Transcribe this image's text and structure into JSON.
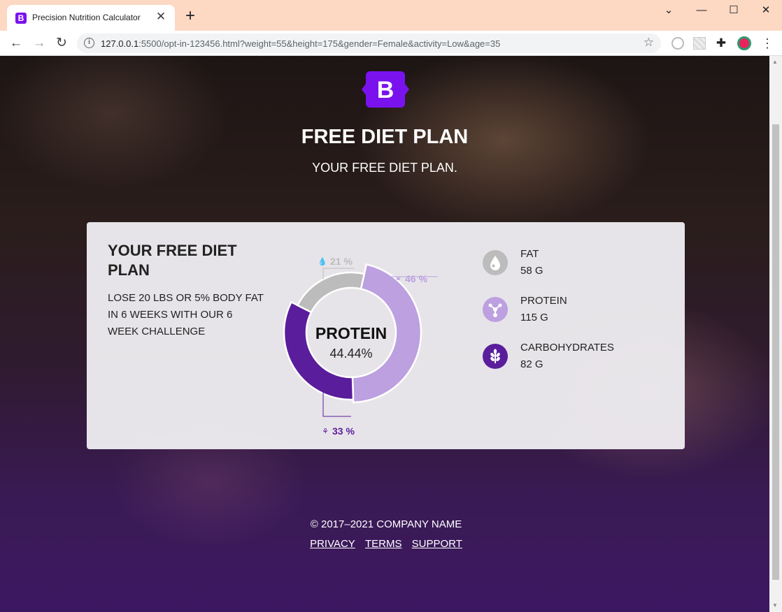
{
  "browser": {
    "tab_title": "Precision Nutrition Calculator",
    "favicon_letter": "B",
    "url_host": "127.0.0.1",
    "url_rest": ":5500/opt-in-123456.html?weight=55&height=175&gender=Female&activity=Low&age=35"
  },
  "hero": {
    "title": "FREE DIET PLAN",
    "subtitle": "YOUR FREE DIET PLAN."
  },
  "card": {
    "title": "YOUR FREE DIET PLAN",
    "description": "LOSE 20 LBS OR 5% BODY FAT IN 6 WEEKS WITH OUR 6 WEEK CHALLENGE",
    "donut": {
      "center_label": "PROTEIN",
      "center_value": "44.44%"
    },
    "macros": [
      {
        "name": "FAT",
        "value": "58 G",
        "color": "#bcbcbc",
        "icon": "drop-icon"
      },
      {
        "name": "PROTEIN",
        "value": "115 G",
        "color": "#bca0e0",
        "icon": "molecule-icon"
      },
      {
        "name": "CARBOHYDRATES",
        "value": "82 G",
        "color": "#5a1d9c",
        "icon": "wheat-icon"
      }
    ]
  },
  "chart_data": {
    "type": "pie",
    "categories": [
      "Protein",
      "Carbohydrates",
      "Fat"
    ],
    "values": [
      46,
      33,
      21
    ],
    "labels": [
      "46 %",
      "33 %",
      "21 %"
    ],
    "colors": [
      "#bca0e0",
      "#5a1d9c",
      "#bcbcbc"
    ]
  },
  "footer": {
    "copyright": "© 2017–2021 COMPANY NAME",
    "links": [
      "PRIVACY",
      "TERMS",
      "SUPPORT"
    ]
  }
}
